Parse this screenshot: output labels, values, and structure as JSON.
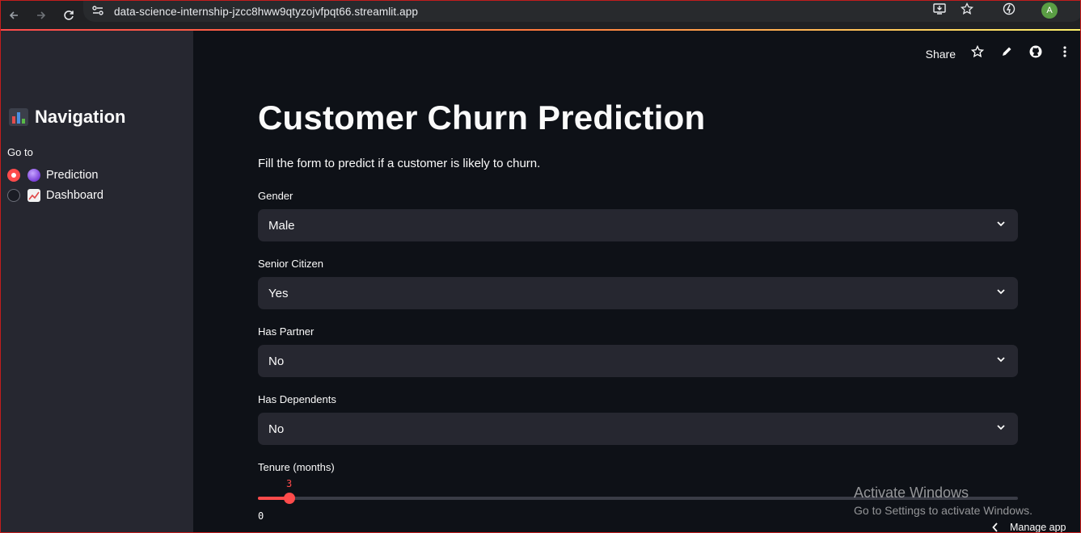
{
  "browser": {
    "url": "data-science-internship-jzcc8hww9qtyzojvfpqt66.streamlit.app",
    "avatar_letter": "A",
    "icons": [
      "back-icon",
      "forward-icon",
      "reload-icon",
      "site-info-icon",
      "install-app-icon",
      "bookmark-star-icon",
      "extension-icon"
    ]
  },
  "toolbar": {
    "share_label": "Share",
    "icons": [
      "star-icon",
      "pencil-icon",
      "github-icon",
      "more-vertical-icon"
    ]
  },
  "sidebar": {
    "title": "Navigation",
    "title_icon": "bar-chart-icon",
    "goto_label": "Go to",
    "options": [
      {
        "label": "Prediction",
        "icon": "crystal-ball-icon",
        "selected": true
      },
      {
        "label": "Dashboard",
        "icon": "trend-up-icon",
        "selected": false
      }
    ]
  },
  "main": {
    "title": "Customer Churn Prediction",
    "description": "Fill the form to predict if a customer is likely to churn.",
    "fields": [
      {
        "label": "Gender",
        "value": "Male"
      },
      {
        "label": "Senior Citizen",
        "value": "Yes"
      },
      {
        "label": "Has Partner",
        "value": "No"
      },
      {
        "label": "Has Dependents",
        "value": "No"
      }
    ],
    "tenure": {
      "label": "Tenure (months)",
      "value": "3",
      "min": "0",
      "max": 72
    }
  },
  "overlay": {
    "activate_title": "Activate Windows",
    "activate_sub": "Go to Settings to activate Windows.",
    "manage_app": "Manage app"
  },
  "colors": {
    "accent": "#ff4b4b",
    "sidebar_bg": "#262730",
    "main_bg": "#0e1117",
    "input_bg": "#262730"
  }
}
